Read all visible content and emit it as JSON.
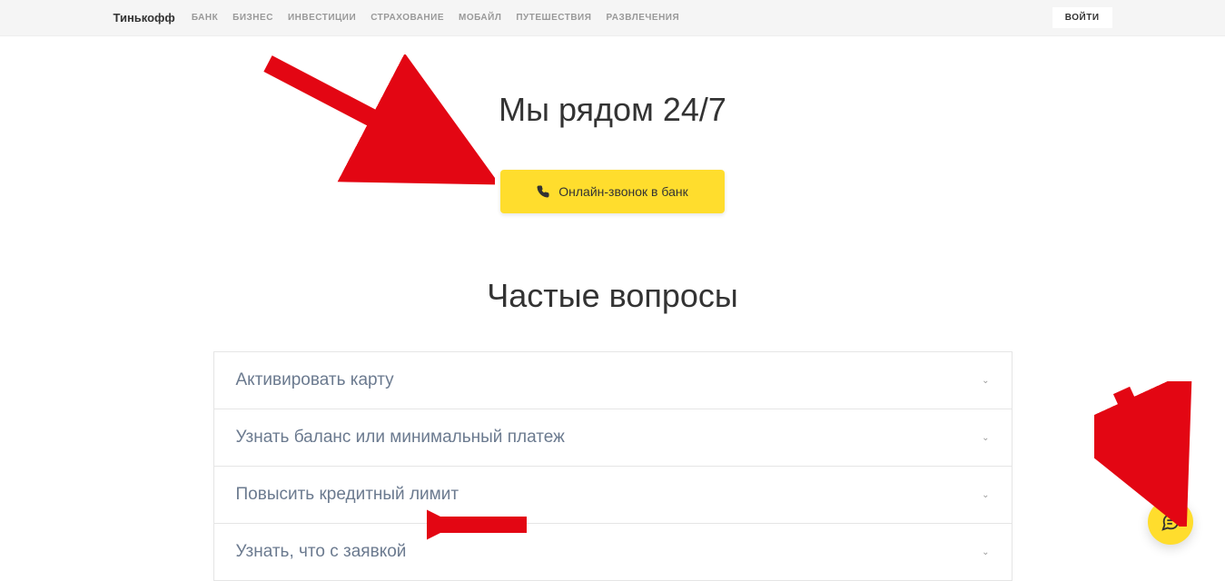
{
  "header": {
    "logo": "Тинькофф",
    "nav": [
      "БАНК",
      "БИЗНЕС",
      "ИНВЕСТИЦИИ",
      "СТРАХОВАНИЕ",
      "МОБАЙЛ",
      "ПУТЕШЕСТВИЯ",
      "РАЗВЛЕЧЕНИЯ"
    ],
    "login": "ВОЙТИ"
  },
  "hero": {
    "title": "Мы рядом 24/7",
    "call_button": "Онлайн-звонок в банк"
  },
  "faq": {
    "title": "Частые вопросы",
    "items": [
      "Активировать карту",
      "Узнать баланс или минимальный платеж",
      "Повысить кредитный лимит",
      "Узнать, что с заявкой"
    ]
  },
  "colors": {
    "accent": "#ffdd2d",
    "arrow": "#e30613"
  }
}
